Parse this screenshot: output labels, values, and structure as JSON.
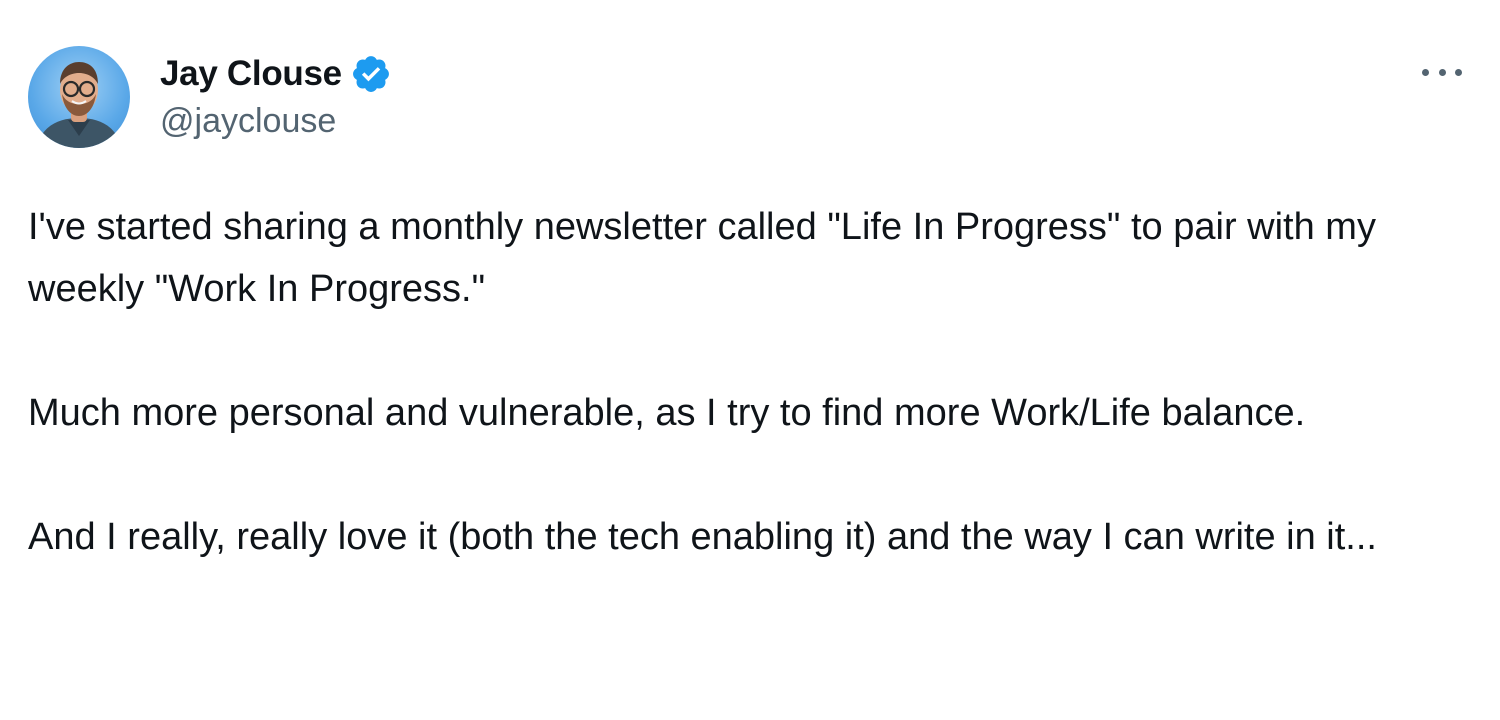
{
  "author": {
    "display_name": "Jay Clouse",
    "handle": "@jayclouse",
    "verified": true,
    "avatar_icon": "avatar-photo"
  },
  "colors": {
    "text": "#0f1419",
    "secondary": "#536471",
    "verified_badge": "#1d9bf0"
  },
  "menu": {
    "icon": "more-options-icon"
  },
  "tweet": {
    "paragraphs": [
      "I've started sharing a monthly newsletter called \"Life In Progress\" to pair with my weekly \"Work In Progress.\"",
      "Much more personal and vulnerable, as I try to find more Work/Life balance.",
      "And I really, really love it (both the tech enabling it) and the way I can write in it..."
    ]
  }
}
